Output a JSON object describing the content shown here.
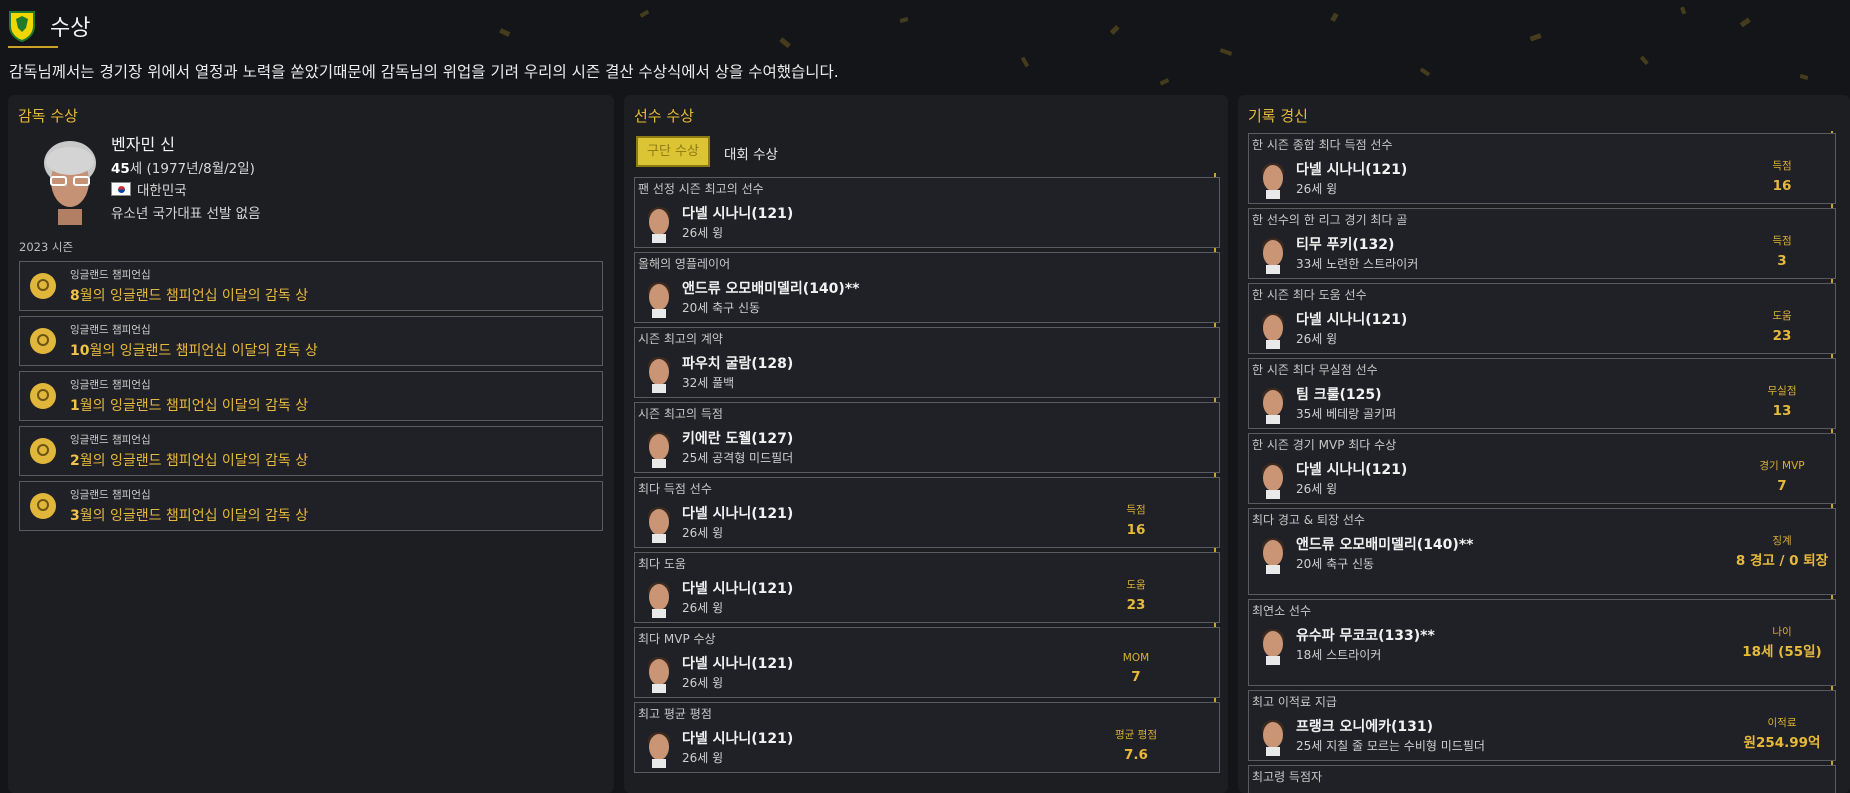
{
  "header": {
    "title": "수상",
    "intro": "감독님께서는 경기장 위에서 열정과 노력을 쏟았기때문에 감독님의 위업을 기려 우리의 시즌 결산 수상식에서 상을 수여했습니다."
  },
  "manager_panel": {
    "title": "감독 수상",
    "name": "벤자민 신",
    "age": "45",
    "age_suffix": "세 (1977년/8월/2일)",
    "nation": "대한민국",
    "youth": "유소년 국가대표 선발 없음",
    "season": "2023 시즌",
    "awards": [
      {
        "competition": "잉글랜드 챔피언십",
        "num": "8",
        "title": "월의 잉글랜드 챔피언십 이달의 감독 상"
      },
      {
        "competition": "잉글랜드 챔피언십",
        "num": "10",
        "title": "월의 잉글랜드 챔피언십 이달의 감독 상"
      },
      {
        "competition": "잉글랜드 챔피언십",
        "num": "1",
        "title": "월의 잉글랜드 챔피언십 이달의 감독 상"
      },
      {
        "competition": "잉글랜드 챔피언십",
        "num": "2",
        "title": "월의 잉글랜드 챔피언십 이달의 감독 상"
      },
      {
        "competition": "잉글랜드 챔피언십",
        "num": "3",
        "title": "월의 잉글랜드 챔피언십 이달의 감독 상"
      }
    ]
  },
  "player_panel": {
    "title": "선수 수상",
    "tab_active": "구단 수상",
    "tab_inactive": "대회 수상",
    "cards": [
      {
        "head": "팬 선정 시즌 최고의 선수",
        "name": "다넬 시나니(121)",
        "desc": "26세 윙",
        "stat_label": "",
        "stat_value": ""
      },
      {
        "head": "올해의 영플레이어",
        "name": "앤드류 오모배미델리(140)**",
        "desc": "20세 축구 신동",
        "stat_label": "",
        "stat_value": ""
      },
      {
        "head": "시즌 최고의 계약",
        "name": "파우치 굴람(128)",
        "desc": "32세 풀백",
        "stat_label": "",
        "stat_value": ""
      },
      {
        "head": "시즌 최고의 득점",
        "name": "키에란 도웰(127)",
        "desc": "25세 공격형 미드필더",
        "stat_label": "",
        "stat_value": ""
      },
      {
        "head": "최다 득점 선수",
        "name": "다넬 시나니(121)",
        "desc": "26세 윙",
        "stat_label": "득점",
        "stat_value": "16"
      },
      {
        "head": "최다 도움",
        "name": "다넬 시나니(121)",
        "desc": "26세 윙",
        "stat_label": "도움",
        "stat_value": "23"
      },
      {
        "head": "최다 MVP 수상",
        "name": "다넬 시나니(121)",
        "desc": "26세 윙",
        "stat_label": "MOM",
        "stat_value": "7"
      },
      {
        "head": "최고 평균 평점",
        "name": "다넬 시나니(121)",
        "desc": "26세 윙",
        "stat_label": "평균 평점",
        "stat_value": "7.6"
      }
    ]
  },
  "records_panel": {
    "title": "기록 경신",
    "cards": [
      {
        "head": "한 시즌 종합 최다 득점 선수",
        "name": "다넬 시나니(121)",
        "desc": "26세 윙",
        "stat_label": "득점",
        "stat_value": "16"
      },
      {
        "head": "한 선수의 한 리그 경기 최다 골",
        "name": "티무 푸키(132)",
        "desc": "33세 노련한 스트라이커",
        "stat_label": "득점",
        "stat_value": "3"
      },
      {
        "head": "한 시즌 최다 도움 선수",
        "name": "다넬 시나니(121)",
        "desc": "26세 윙",
        "stat_label": "도움",
        "stat_value": "23"
      },
      {
        "head": "한 시즌 최다 무실점 선수",
        "name": "팀 크룰(125)",
        "desc": "35세 베테랑 골키퍼",
        "stat_label": "무실점",
        "stat_value": "13"
      },
      {
        "head": "한 시즌 경기 MVP 최다 수상",
        "name": "다넬 시나니(121)",
        "desc": "26세 윙",
        "stat_label": "경기 MVP",
        "stat_value": "7"
      },
      {
        "head": "최다 경고 & 퇴장 선수",
        "name": "앤드류 오모배미델리(140)**",
        "desc": "20세 축구 신동",
        "stat_label": "징계",
        "stat_value": "8 경고 / 0 퇴장"
      },
      {
        "head": "최연소 선수",
        "name": "유수파 무코코(133)**",
        "desc": "18세 스트라이커",
        "stat_label": "나이",
        "stat_value": "18세 (55일)"
      },
      {
        "head": "최고 이적료 지급",
        "name": "프랭크 오니에카(131)",
        "desc": "25세 지칠 줄 모르는 수비형 미드필더",
        "stat_label": "이적료",
        "stat_value": "원254.99억"
      },
      {
        "head": "최고령 득점자",
        "name": "",
        "desc": "",
        "stat_label": "",
        "stat_value": ""
      }
    ]
  },
  "colors": {
    "accent": "#e7b93b",
    "background": "#141518",
    "panel": "#1d1e22"
  }
}
